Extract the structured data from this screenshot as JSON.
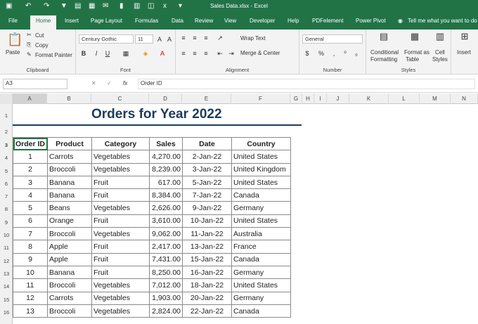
{
  "window": {
    "title": "Sales Data.xlsx - Excel"
  },
  "tabs": [
    "File",
    "Home",
    "Insert",
    "Page Layout",
    "Formulas",
    "Data",
    "Review",
    "View",
    "Developer",
    "Help",
    "PDFelement",
    "Power Pivot"
  ],
  "tell_me": "Tell me what you want to do",
  "ribbon": {
    "clipboard": {
      "paste": "Paste",
      "cut": "Cut",
      "copy": "Copy",
      "format_painter": "Format Painter",
      "label": "Clipboard"
    },
    "font": {
      "name": "Century Gothic",
      "size": "11",
      "bold": "B",
      "italic": "I",
      "underline": "U",
      "label": "Font"
    },
    "alignment": {
      "wrap_text": "Wrap Text",
      "merge_center": "Merge & Center",
      "label": "Alignment"
    },
    "number": {
      "format": "General",
      "currency": "$",
      "percent": "%",
      "comma": ",",
      "label": "Number"
    },
    "styles": {
      "conditional": "Conditional",
      "conditional2": "Formatting",
      "format_as": "Format as",
      "format_as2": "Table",
      "cell": "Cell",
      "cell2": "Styles",
      "label": "Styles"
    },
    "insert": "Insert"
  },
  "formula_bar": {
    "name_box": "A3",
    "fx": "fx",
    "content": "Order ID"
  },
  "columns": [
    "A",
    "B",
    "C",
    "D",
    "E",
    "F",
    "G",
    "H",
    "I",
    "J",
    "K",
    "L",
    "M",
    "N"
  ],
  "rows": [
    "1",
    "2",
    "3",
    "4",
    "5",
    "6",
    "7",
    "8",
    "9",
    "10",
    "11",
    "12",
    "13",
    "14",
    "15",
    "16"
  ],
  "sheet": {
    "title": "Orders for Year 2022",
    "headers": [
      "Order ID",
      "Product",
      "Category",
      "Sales",
      "Date",
      "Country"
    ],
    "data": [
      [
        "1",
        "Carrots",
        "Vegetables",
        "4,270.00",
        "2-Jan-22",
        "United States"
      ],
      [
        "2",
        "Broccoli",
        "Vegetables",
        "8,239.00",
        "3-Jan-22",
        "United Kingdom"
      ],
      [
        "3",
        "Banana",
        "Fruit",
        "617.00",
        "5-Jan-22",
        "United States"
      ],
      [
        "4",
        "Banana",
        "Fruit",
        "8,384.00",
        "7-Jan-22",
        "Canada"
      ],
      [
        "5",
        "Beans",
        "Vegetables",
        "2,626.00",
        "9-Jan-22",
        "Germany"
      ],
      [
        "6",
        "Orange",
        "Fruit",
        "3,610.00",
        "10-Jan-22",
        "United States"
      ],
      [
        "7",
        "Broccoli",
        "Vegetables",
        "9,062.00",
        "11-Jan-22",
        "Australia"
      ],
      [
        "8",
        "Apple",
        "Fruit",
        "2,417.00",
        "13-Jan-22",
        "France"
      ],
      [
        "9",
        "Apple",
        "Fruit",
        "7,431.00",
        "15-Jan-22",
        "Canada"
      ],
      [
        "10",
        "Banana",
        "Fruit",
        "8,250.00",
        "16-Jan-22",
        "Germany"
      ],
      [
        "11",
        "Broccoli",
        "Vegetables",
        "7,012.00",
        "18-Jan-22",
        "United States"
      ],
      [
        "12",
        "Carrots",
        "Vegetables",
        "1,903.00",
        "20-Jan-22",
        "Germany"
      ],
      [
        "13",
        "Broccoli",
        "Vegetables",
        "2,824.00",
        "22-Jan-22",
        "Canada"
      ]
    ]
  },
  "colors": {
    "accent": "#217346",
    "title": "#1f3b5a"
  }
}
